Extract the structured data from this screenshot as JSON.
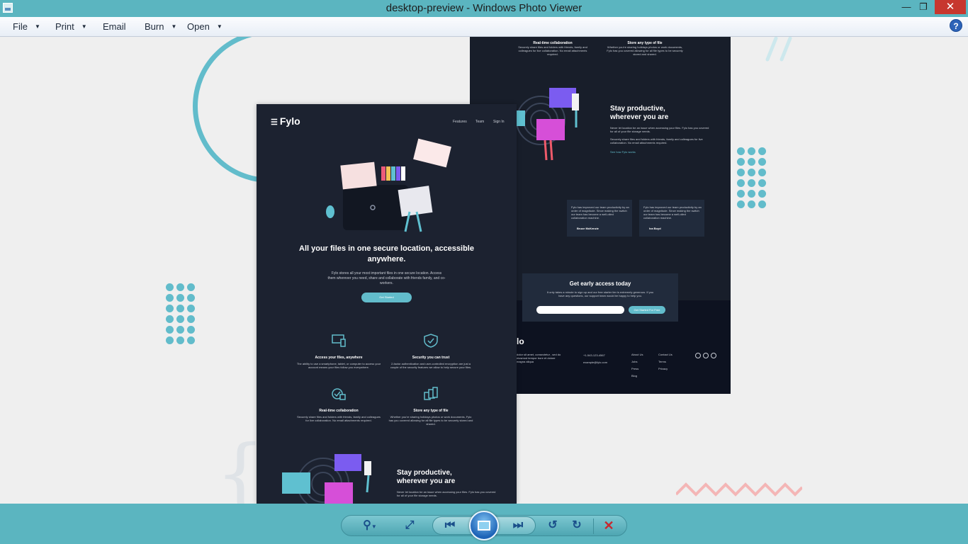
{
  "window": {
    "title": "desktop-preview - Windows Photo Viewer"
  },
  "menu": {
    "items": [
      "File",
      "Print",
      "Email",
      "Burn",
      "Open"
    ]
  },
  "preview_back": {
    "features_top": [
      {
        "title": "Real-time collaboration",
        "desc": "Securely share files and folders with friends, family and colleagues for live collaboration. No email attachments required."
      },
      {
        "title": "Store any type of file",
        "desc": "Whether you're sharing holidays photos or work documents, Fylo has you covered allowing for all file types to be securely stored and shared."
      }
    ],
    "productive_title": "Stay productive, wherever you are",
    "productive_p1": "Never let location be an issue when accessing your files. Fylo has you covered for all of your file storage needs.",
    "productive_p2": "Securely share files and folders with friends, family and colleagues for live collaboration. No email attachments required.",
    "productive_link": "See how Fylo works",
    "testimonials": [
      "Fylo has improved our team productivity by an order of magnitude. Since making the switch our team has become a well-oiled collaboration machine.",
      "Fylo has improved our team productivity by an order of magnitude. Since making the switch our team has become a well-oiled collaboration machine.",
      "Fylo has improved our team productivity by an order of magnitude. Since making the switch our team has become a well-oiled collaboration machine."
    ],
    "testimonial_names": [
      "",
      "Bruce McKenzie",
      "Iva Boyd"
    ],
    "early_access_title": "Get early access today",
    "early_access_desc": "It only takes a minute to sign up and our free starter tier is extremely generous. If you have any questions, our support team would be happy to help you.",
    "early_access_button": "Get Started For Free",
    "footer_logo": "lo",
    "footer_phone": "+1-543-123-4567",
    "footer_email": "example@fylo.com",
    "footer_about": "dolor sit amet, consectetur , sed do eiusmod tempor bore et dolore magna aliqua",
    "footer_links_a": [
      "About Us",
      "Jobs",
      "Press",
      "Blog"
    ],
    "footer_links_b": [
      "Contact Us",
      "Terms",
      "Privacy"
    ]
  },
  "preview_front": {
    "logo": "Fylo",
    "nav": [
      "Features",
      "Team",
      "Sign In"
    ],
    "hero_title": "All your files in one secure location, accessible anywhere.",
    "hero_desc": "Fylo stores all your most important files in one secure location. Access them wherever you need, share and collaborate with friends family, and co-workers.",
    "hero_button": "Get Started",
    "features": [
      {
        "title": "Access your files, anywhere",
        "desc": "The ability to use a smartphone, tablet, or computer to access your account means your files follow you everywhere."
      },
      {
        "title": "Security you can trust",
        "desc": "2-factor authentication and user-controlled encryption are just a couple of the security features we allow to help secure your files."
      },
      {
        "title": "Real-time collaboration",
        "desc": "Securely share files and folders with friends, family and colleagues for live collaboration. No email attachments required."
      },
      {
        "title": "Store any type of file",
        "desc": "Whether you're sharing holidays photos or work documents, Fylo has you covered allowing for all file types to be securely stored and shared."
      }
    ],
    "productive_title": "Stay productive, wherever you are",
    "productive_desc": "Never let location be an issue when accessing your files. Fylo has you covered for all of your file storage needs."
  },
  "toolbar": {
    "buttons": [
      "zoom-icon",
      "actual-size-icon",
      "previous-icon",
      "slideshow-icon",
      "next-icon",
      "rotate-ccw-icon",
      "rotate-cw-icon",
      "delete-icon"
    ]
  },
  "colors": {
    "accent": "#5bb5c0",
    "page_dark": "#1c2230",
    "cyan": "#62bccb",
    "pink": "#f4b6b6"
  }
}
